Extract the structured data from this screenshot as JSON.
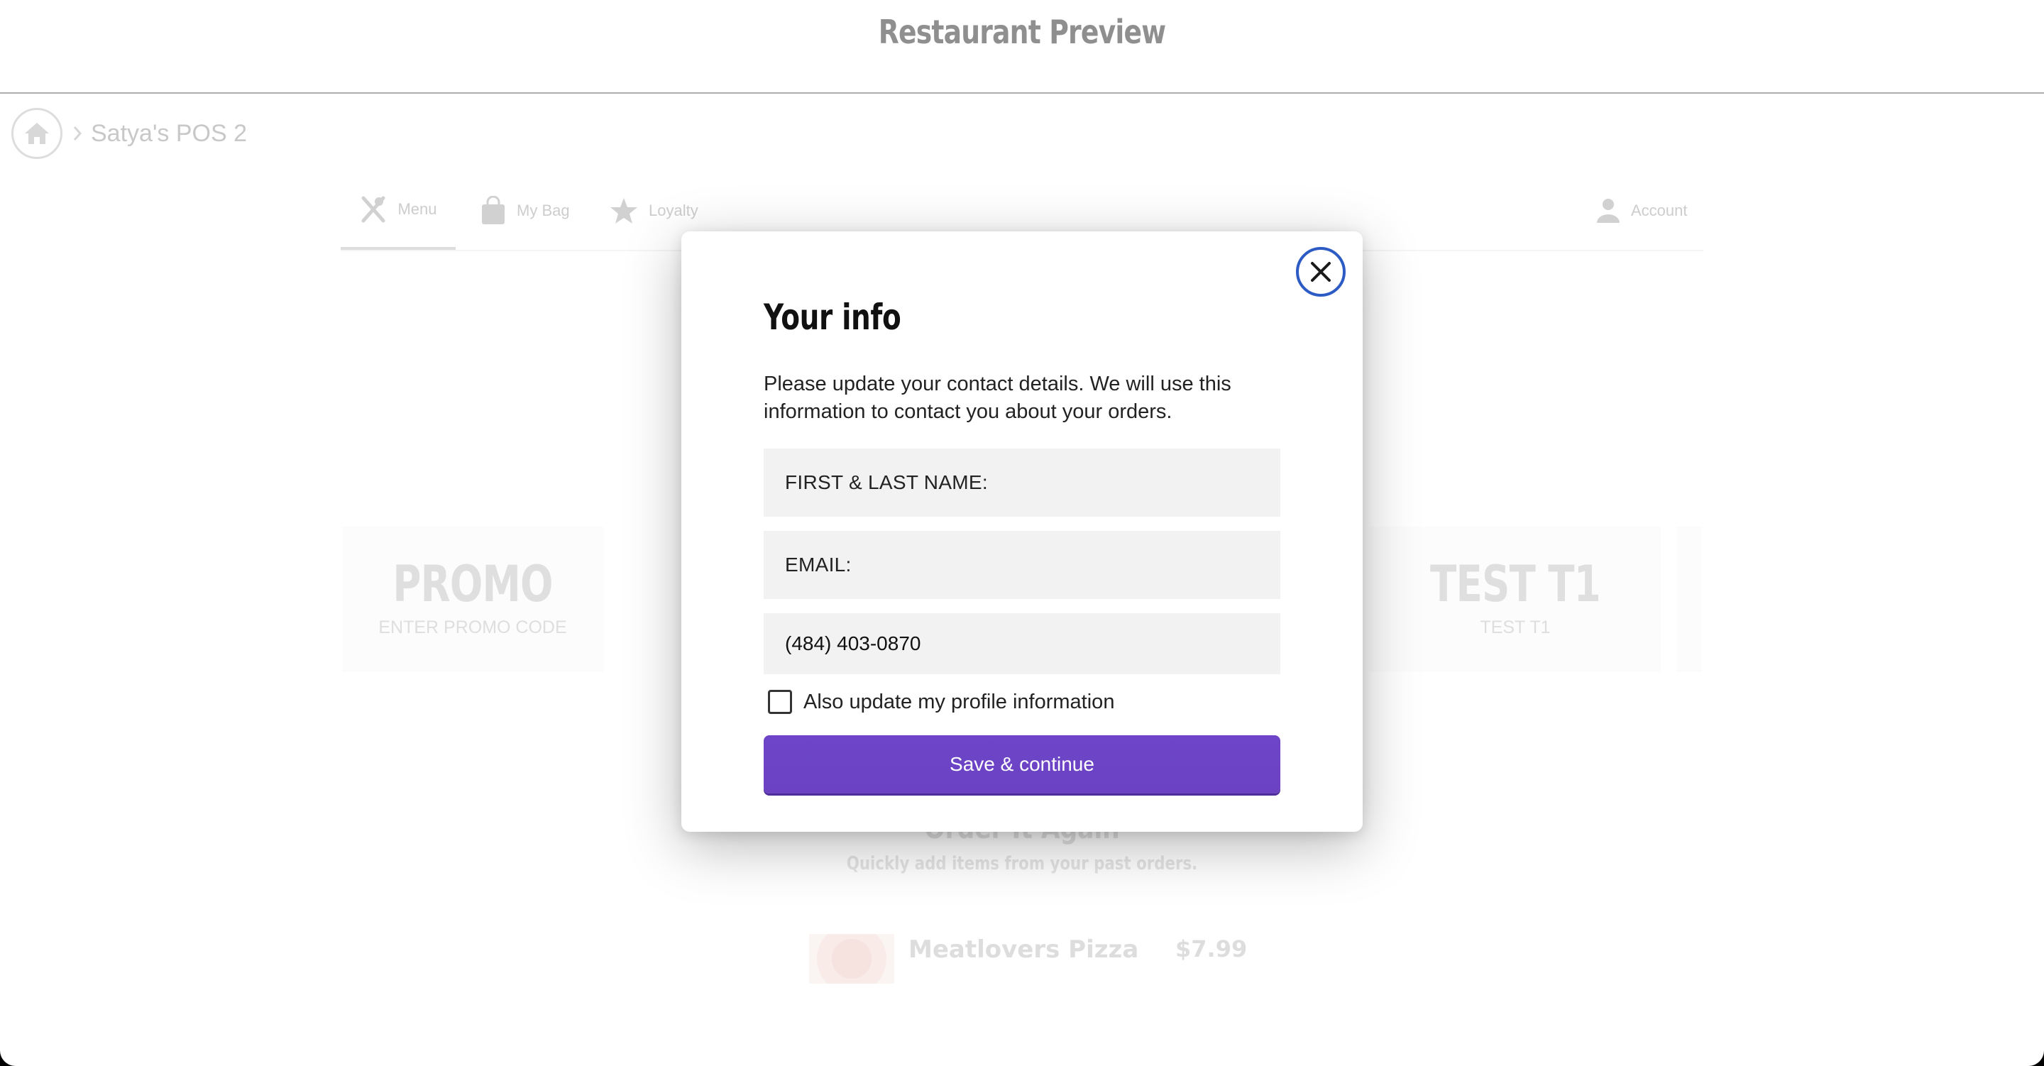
{
  "app": {
    "title": "Restaurant Preview"
  },
  "breadcrumb": {
    "current": "Satya's POS 2"
  },
  "nav": {
    "items": [
      {
        "label": "Menu",
        "icon": "fork-knife-icon",
        "active": true
      },
      {
        "label": "My Bag",
        "icon": "shopping-bag-icon",
        "active": false
      },
      {
        "label": "Loyalty",
        "icon": "star-icon",
        "active": false
      }
    ],
    "account": {
      "label": "Account",
      "icon": "person-icon"
    }
  },
  "banners": [
    {
      "title": "PROMO",
      "subtitle": "ENTER PROMO CODE"
    },
    {
      "title": "TEST T1",
      "subtitle": "TEST T1"
    }
  ],
  "order_again": {
    "title": "Order It Again",
    "subtitle": "Quickly add items from your past orders.",
    "items": [
      {
        "name": "Meatlovers Pizza",
        "price": "$7.99"
      }
    ]
  },
  "modal": {
    "title": "Your info",
    "description": "Please update your contact details. We will use this information to contact you about your orders.",
    "name_placeholder": "FIRST & LAST NAME:",
    "email_placeholder": "EMAIL:",
    "phone_value": "(484) 403-0870",
    "checkbox_label": "Also update my profile information",
    "checkbox_checked": false,
    "save_label": "Save & continue"
  },
  "colors": {
    "accent": "#6b43c4",
    "close_ring": "#2d5bc4"
  }
}
